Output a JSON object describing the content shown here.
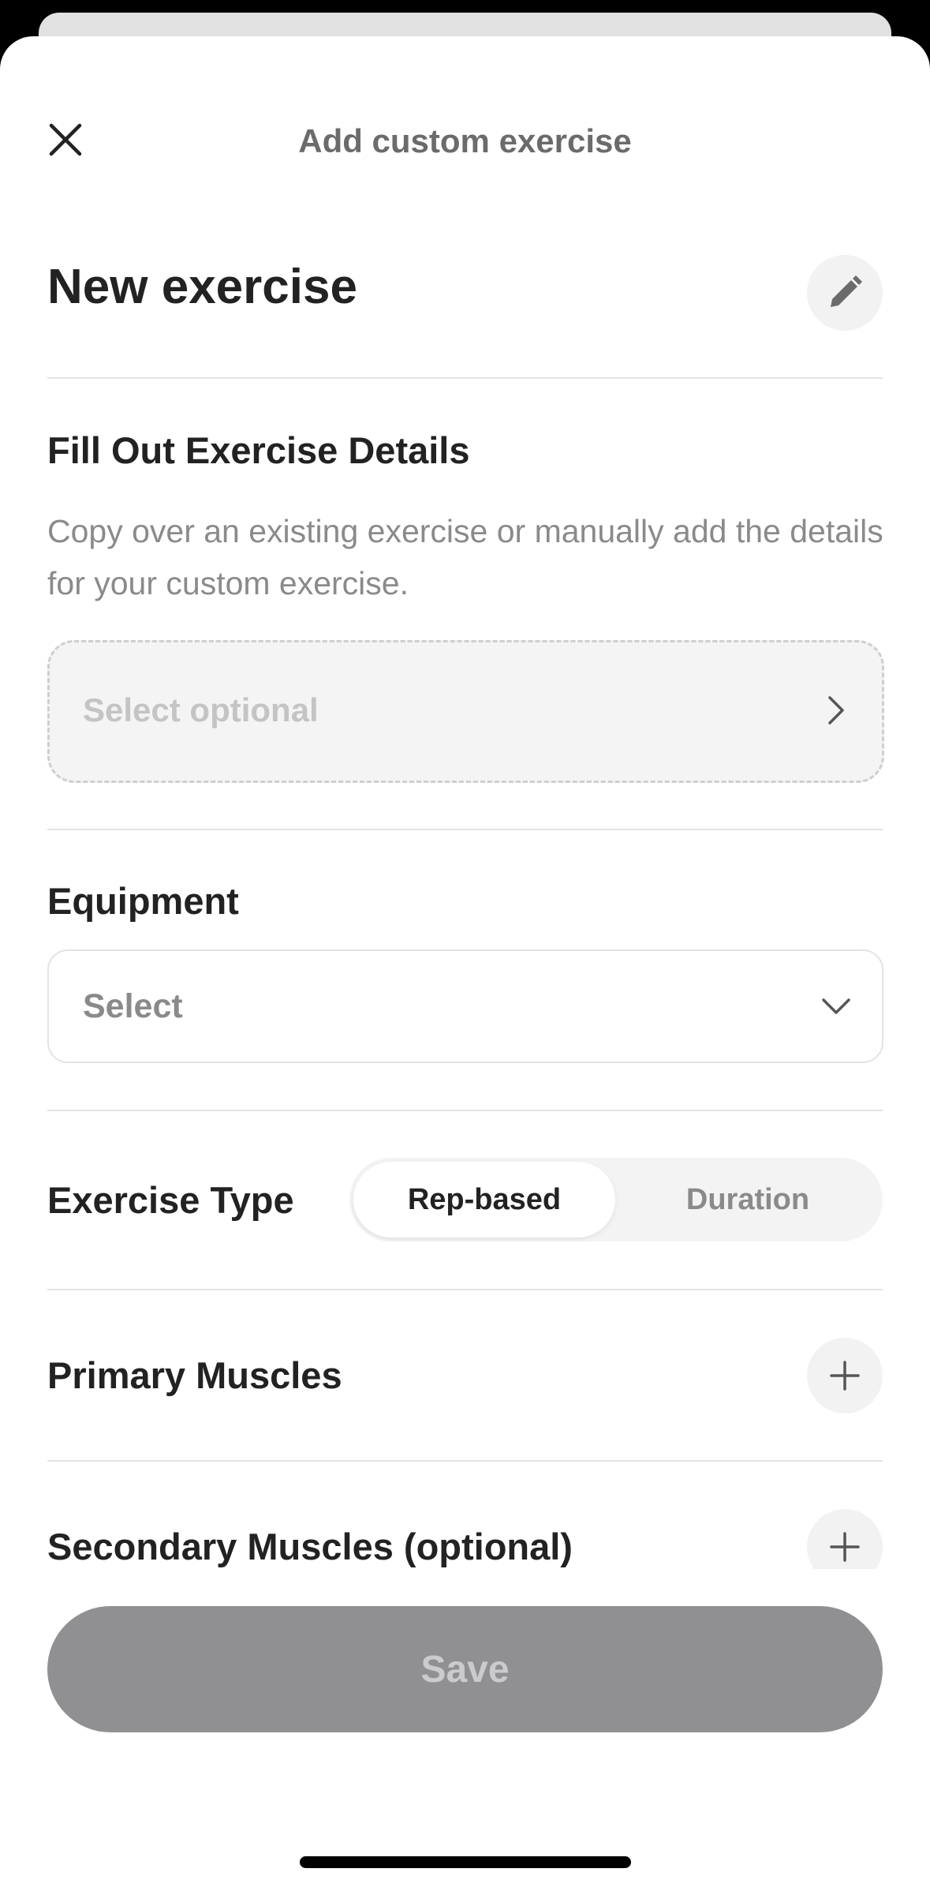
{
  "header": {
    "title": "Add custom exercise",
    "close_icon": "close-icon"
  },
  "exercise": {
    "name": "New exercise",
    "edit_icon": "pencil-icon"
  },
  "details": {
    "title": "Fill Out Exercise Details",
    "description": "Copy over an existing exercise or manually add the details for your custom exercise.",
    "copy_placeholder": "Select optional",
    "copy_icon": "chevron-right-icon"
  },
  "equipment": {
    "title": "Equipment",
    "value": "Select",
    "icon": "chevron-down-icon"
  },
  "exercise_type": {
    "title": "Exercise Type",
    "options": [
      "Rep-based",
      "Duration"
    ],
    "selected": "Rep-based"
  },
  "primary_muscles": {
    "title": "Primary Muscles",
    "icon": "plus-icon"
  },
  "secondary_muscles": {
    "title": "Secondary Muscles (optional)",
    "icon": "plus-icon"
  },
  "footer": {
    "save_label": "Save"
  },
  "colors": {
    "text_primary": "#222222",
    "text_secondary": "#8a8a8a",
    "save_disabled": "#909092",
    "divider": "#e4e4e4"
  }
}
